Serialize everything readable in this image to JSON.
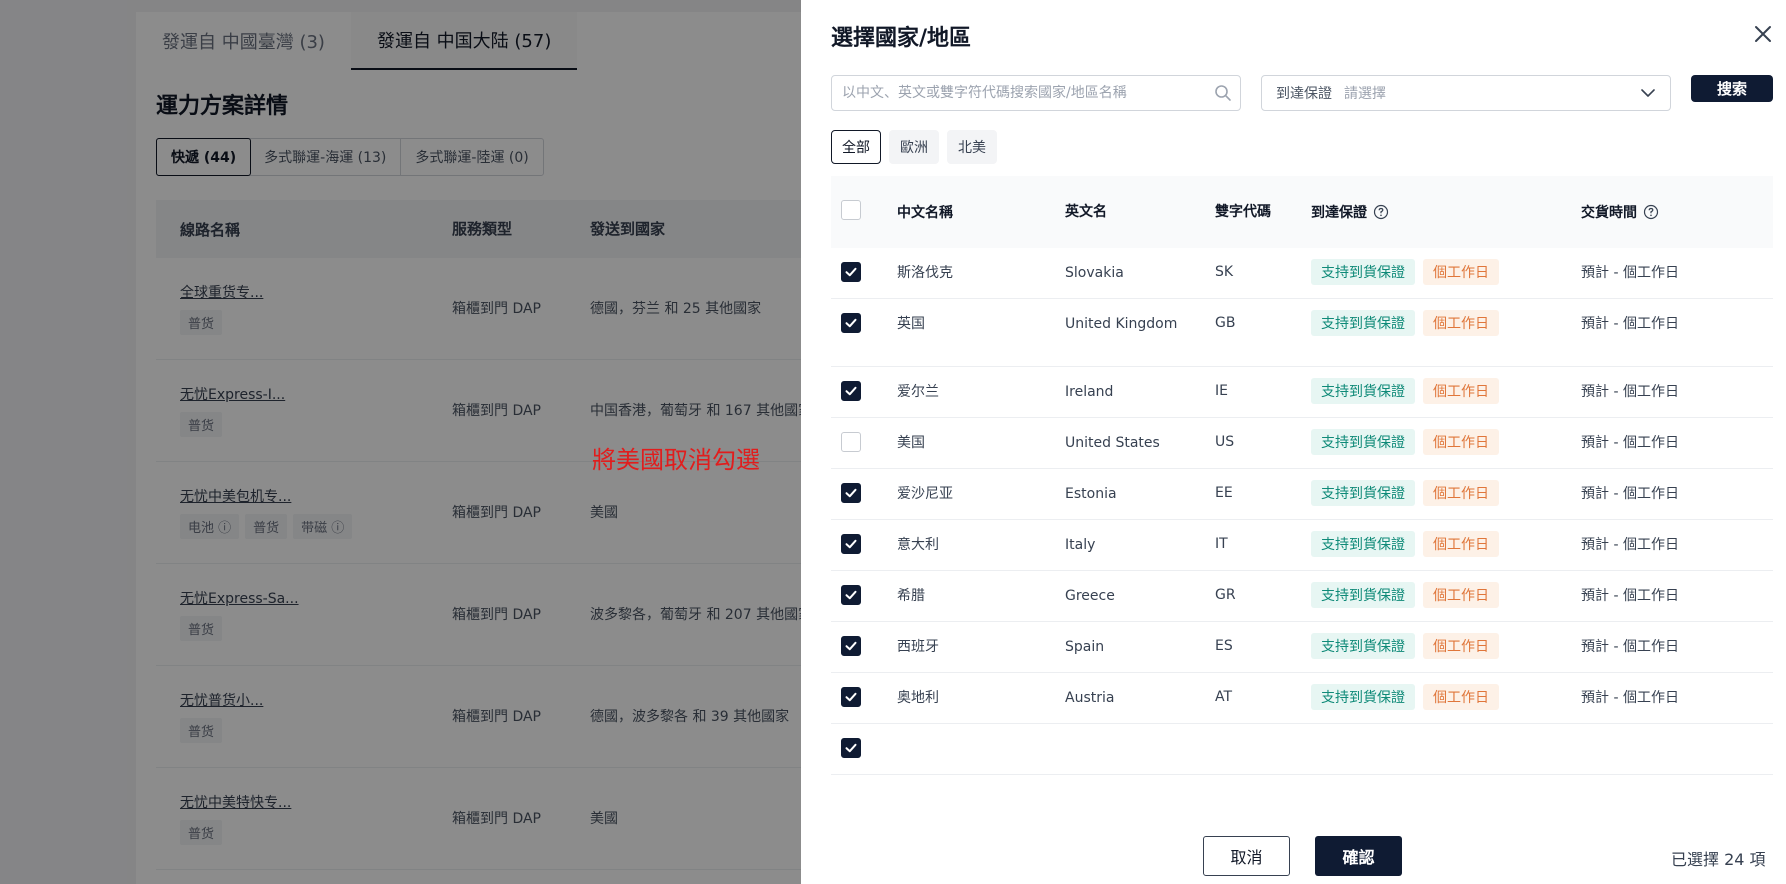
{
  "background": {
    "tabs": [
      "發運自 中國臺灣 (3)",
      "發運自 中国大陆 (57)"
    ],
    "active_tab": 1,
    "heading": "運力方案詳情",
    "segments": [
      "快遞 (44)",
      "多式聯運-海運 (13)",
      "多式聯運-陸運 (0)"
    ],
    "table_headers": [
      "線路名稱",
      "服務類型",
      "發送到國家"
    ],
    "rows": [
      {
        "name": "全球重货专...",
        "tags": [
          "普货"
        ],
        "service": "箱櫃到門 DAP",
        "dest": "德國，芬兰 和 25 其他國家"
      },
      {
        "name": "无忧Express-I...",
        "tags": [
          "普货"
        ],
        "service": "箱櫃到門 DAP",
        "dest": "中国香港，葡萄牙 和 167 其他國家"
      },
      {
        "name": "无忧中美包机专...",
        "tags": [
          "电池 ⓘ",
          "普货",
          "带磁 ⓘ"
        ],
        "service": "箱櫃到門 DAP",
        "dest": "美國"
      },
      {
        "name": "无忧Express-Sa...",
        "tags": [
          "普货"
        ],
        "service": "箱櫃到門 DAP",
        "dest": "波多黎各，葡萄牙 和 207 其他國家"
      },
      {
        "name": "无忧普货小...",
        "tags": [
          "普货"
        ],
        "service": "箱櫃到門 DAP",
        "dest": "德國，波多黎各 和 39 其他國家"
      },
      {
        "name": "无忧中美特快专...",
        "tags": [
          "普货"
        ],
        "service": "箱櫃到門 DAP",
        "dest": "美國"
      }
    ]
  },
  "annotation": {
    "text": "將美國取消勾選",
    "color": "#e11d1d"
  },
  "drawer": {
    "title": "選擇國家/地區",
    "search_placeholder": "以中文、英文或雙字符代碼搜索國家/地區名稱",
    "guarantee_label": "到達保證",
    "guarantee_placeholder": "請選擇",
    "search_button": "搜索",
    "chips": [
      "全部",
      "歐洲",
      "北美"
    ],
    "active_chip": 0,
    "headers": {
      "cn": "中文名稱",
      "en": "英文名",
      "code": "雙字代碼",
      "guarantee": "到達保證",
      "time": "交貨時間"
    },
    "rows": [
      {
        "checked": true,
        "cn": "斯洛伐克",
        "en": "Slovakia",
        "code": "SK",
        "g1": "支持到貨保證",
        "g2": "個工作日",
        "time": "預計 - 個工作日"
      },
      {
        "checked": true,
        "cn": "英国",
        "en": "United Kingdom",
        "code": "GB",
        "g1": "支持到貨保證",
        "g2": "個工作日",
        "time": "預計 - 個工作日"
      },
      {
        "checked": true,
        "cn": "爱尔兰",
        "en": "Ireland",
        "code": "IE",
        "g1": "支持到貨保證",
        "g2": "個工作日",
        "time": "預計 - 個工作日"
      },
      {
        "checked": false,
        "cn": "美国",
        "en": "United States",
        "code": "US",
        "g1": "支持到貨保證",
        "g2": "個工作日",
        "time": "預計 - 個工作日"
      },
      {
        "checked": true,
        "cn": "爱沙尼亚",
        "en": "Estonia",
        "code": "EE",
        "g1": "支持到貨保證",
        "g2": "個工作日",
        "time": "預計 - 個工作日"
      },
      {
        "checked": true,
        "cn": "意大利",
        "en": "Italy",
        "code": "IT",
        "g1": "支持到貨保證",
        "g2": "個工作日",
        "time": "預計 - 個工作日"
      },
      {
        "checked": true,
        "cn": "希腊",
        "en": "Greece",
        "code": "GR",
        "g1": "支持到貨保證",
        "g2": "個工作日",
        "time": "預計 - 個工作日"
      },
      {
        "checked": true,
        "cn": "西班牙",
        "en": "Spain",
        "code": "ES",
        "g1": "支持到貨保證",
        "g2": "個工作日",
        "time": "預計 - 個工作日"
      },
      {
        "checked": true,
        "cn": "奥地利",
        "en": "Austria",
        "code": "AT",
        "g1": "支持到貨保證",
        "g2": "個工作日",
        "time": "預計 - 個工作日"
      },
      {
        "checked": true,
        "cn": "",
        "en": "",
        "code": "",
        "g1": "",
        "g2": "",
        "time": ""
      }
    ],
    "cancel": "取消",
    "confirm": "確認",
    "selected": "已選擇 24 項"
  }
}
